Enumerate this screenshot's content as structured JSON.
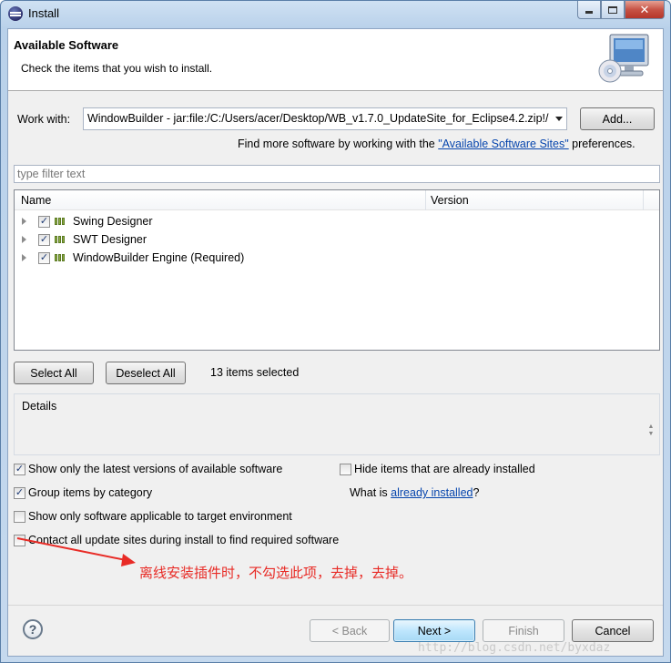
{
  "window": {
    "title": "Install"
  },
  "banner": {
    "title": "Available Software",
    "description": "Check the items that you wish to install."
  },
  "work_with": {
    "label": "Work with:",
    "value": "WindowBuilder - jar:file:/C:/Users/acer/Desktop/WB_v1.7.0_UpdateSite_for_Eclipse4.2.zip!/",
    "add_button": "Add..."
  },
  "find_more": {
    "prefix": "Find more software by working with the ",
    "link": "\"Available Software Sites\"",
    "suffix": " preferences."
  },
  "filter": {
    "placeholder": "type filter text"
  },
  "tree": {
    "columns": [
      "Name",
      "Version"
    ],
    "items": [
      {
        "label": "Swing Designer",
        "checked": true
      },
      {
        "label": "SWT Designer",
        "checked": true
      },
      {
        "label": "WindowBuilder Engine (Required)",
        "checked": true
      }
    ]
  },
  "selection": {
    "select_all": "Select All",
    "deselect_all": "Deselect All",
    "status": "13 items selected"
  },
  "details": {
    "title": "Details"
  },
  "options": {
    "latest_versions": {
      "label": "Show only the latest versions of available software",
      "checked": true
    },
    "hide_installed": {
      "label": "Hide items that are already installed",
      "checked": false
    },
    "group_by_category": {
      "label": "Group items by category",
      "checked": true
    },
    "what_is_prefix": "What is ",
    "what_is_link": "already installed",
    "what_is_suffix": "?",
    "target_env": {
      "label": "Show only software applicable to target environment",
      "checked": false
    },
    "contact_sites": {
      "label": "Contact all update sites during install to find required software",
      "checked": false
    }
  },
  "annotation": {
    "text": "离线安装插件时，不勾选此项，去掉，去掉。",
    "color": "#e82b26"
  },
  "footer": {
    "back": "< Back",
    "next": "Next >",
    "finish": "Finish",
    "cancel": "Cancel"
  },
  "watermark": "http://blog.csdn.net/byxdaz"
}
